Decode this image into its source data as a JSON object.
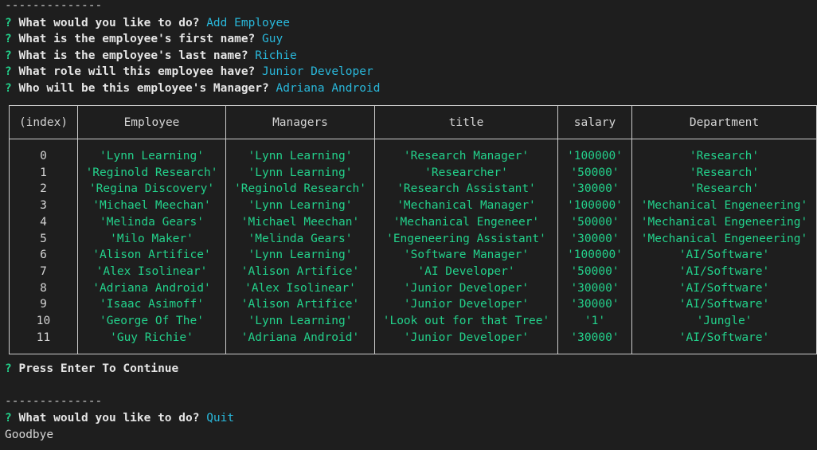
{
  "terminal": {
    "top_separator": "--------------",
    "q_mark": "?",
    "prompts": [
      {
        "question": "What would you like to do?",
        "answer": "Add Employee"
      },
      {
        "question": "What is the employee's first name?",
        "answer": "Guy"
      },
      {
        "question": "What is the employee's last name?",
        "answer": "Richie"
      },
      {
        "question": "What role will this employee have?",
        "answer": "Junior Developer"
      },
      {
        "question": "Who will be this employee's Manager?",
        "answer": "Adriana Android"
      }
    ],
    "press_enter": "Press Enter To Continue",
    "bottom_separator": "--------------",
    "final_prompt": {
      "question": "What would you like to do?",
      "answer": "Quit"
    },
    "goodbye": "Goodbye"
  },
  "table": {
    "headers": [
      "(index)",
      "Employee",
      "Managers",
      "title",
      "salary",
      "Department"
    ],
    "rows": [
      [
        "0",
        "'Lynn Learning'",
        "'Lynn Learning'",
        "'Research Manager'",
        "'100000'",
        "'Research'"
      ],
      [
        "1",
        "'Reginold Research'",
        "'Lynn Learning'",
        "'Researcher'",
        "'50000'",
        "'Research'"
      ],
      [
        "2",
        "'Regina Discovery'",
        "'Reginold Research'",
        "'Research Assistant'",
        "'30000'",
        "'Research'"
      ],
      [
        "3",
        "'Michael Meechan'",
        "'Lynn Learning'",
        "'Mechanical Manager'",
        "'100000'",
        "'Mechanical Engeneering'"
      ],
      [
        "4",
        "'Melinda Gears'",
        "'Michael Meechan'",
        "'Mechanical Engeneer'",
        "'50000'",
        "'Mechanical Engeneering'"
      ],
      [
        "5",
        "'Milo Maker'",
        "'Melinda Gears'",
        "'Engeneering Assistant'",
        "'30000'",
        "'Mechanical Engeneering'"
      ],
      [
        "6",
        "'Alison Artifice'",
        "'Lynn Learning'",
        "'Software Manager'",
        "'100000'",
        "'AI/Software'"
      ],
      [
        "7",
        "'Alex Isolinear'",
        "'Alison Artifice'",
        "'AI Developer'",
        "'50000'",
        "'AI/Software'"
      ],
      [
        "8",
        "'Adriana Android'",
        "'Alex Isolinear'",
        "'Junior Developer'",
        "'30000'",
        "'AI/Software'"
      ],
      [
        "9",
        "'Isaac Asimoff'",
        "'Alison Artifice'",
        "'Junior Developer'",
        "'30000'",
        "'AI/Software'"
      ],
      [
        "10",
        "'George Of The'",
        "'Lynn Learning'",
        "'Look out for that Tree'",
        "'1'",
        "'Jungle'"
      ],
      [
        "11",
        "'Guy Richie'",
        "'Adriana Android'",
        "'Junior Developer'",
        "'30000'",
        "'AI/Software'"
      ]
    ]
  },
  "colors": {
    "background": "#1e1e1e",
    "question_mark": "#23d18b",
    "answer": "#29b8db",
    "string_value": "#23d18b",
    "text": "#d4d4d4"
  }
}
